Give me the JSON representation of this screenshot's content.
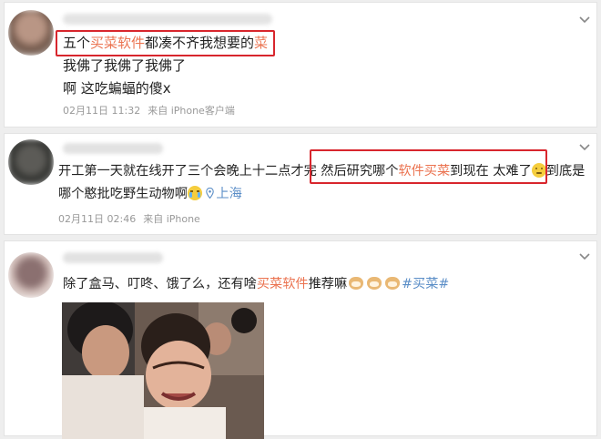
{
  "posts": [
    {
      "text": {
        "seg1": "五个",
        "seg2": "买菜软件",
        "seg3": "都凑不齐我想要的",
        "seg4": "菜"
      },
      "line2": "我佛了我佛了我佛了",
      "line3": "啊 这吃蝙蝠的傻x",
      "meta": {
        "time": "02月11日 11:32",
        "source": "来自 iPhone客户端"
      }
    },
    {
      "line1": {
        "seg1": "开工第一天就在线开了三个会晚上十二点才完 然后研究哪个",
        "seg2": "软件买菜",
        "seg3": "到现在 太难了",
        "seg4": "到底是"
      },
      "line2": "哪个憨批吃野生动物啊",
      "location": "上海",
      "meta": {
        "time": "02月11日 02:46",
        "source": "来自 iPhone"
      }
    },
    {
      "line1": {
        "seg1": "除了盒马、叮咚、饿了么，还有啥",
        "seg2": "买菜软件",
        "seg3": "推荐嘛",
        "tag": "#买菜#"
      }
    }
  ],
  "colors": {
    "highlight": "#eb7350",
    "link": "#5b8ec7",
    "annotation": "#d8262d"
  },
  "icons": [
    "chevron-down-icon",
    "location-pin-icon",
    "doge-emoji",
    "sad-face-emoji",
    "crying-face-emoji"
  ]
}
